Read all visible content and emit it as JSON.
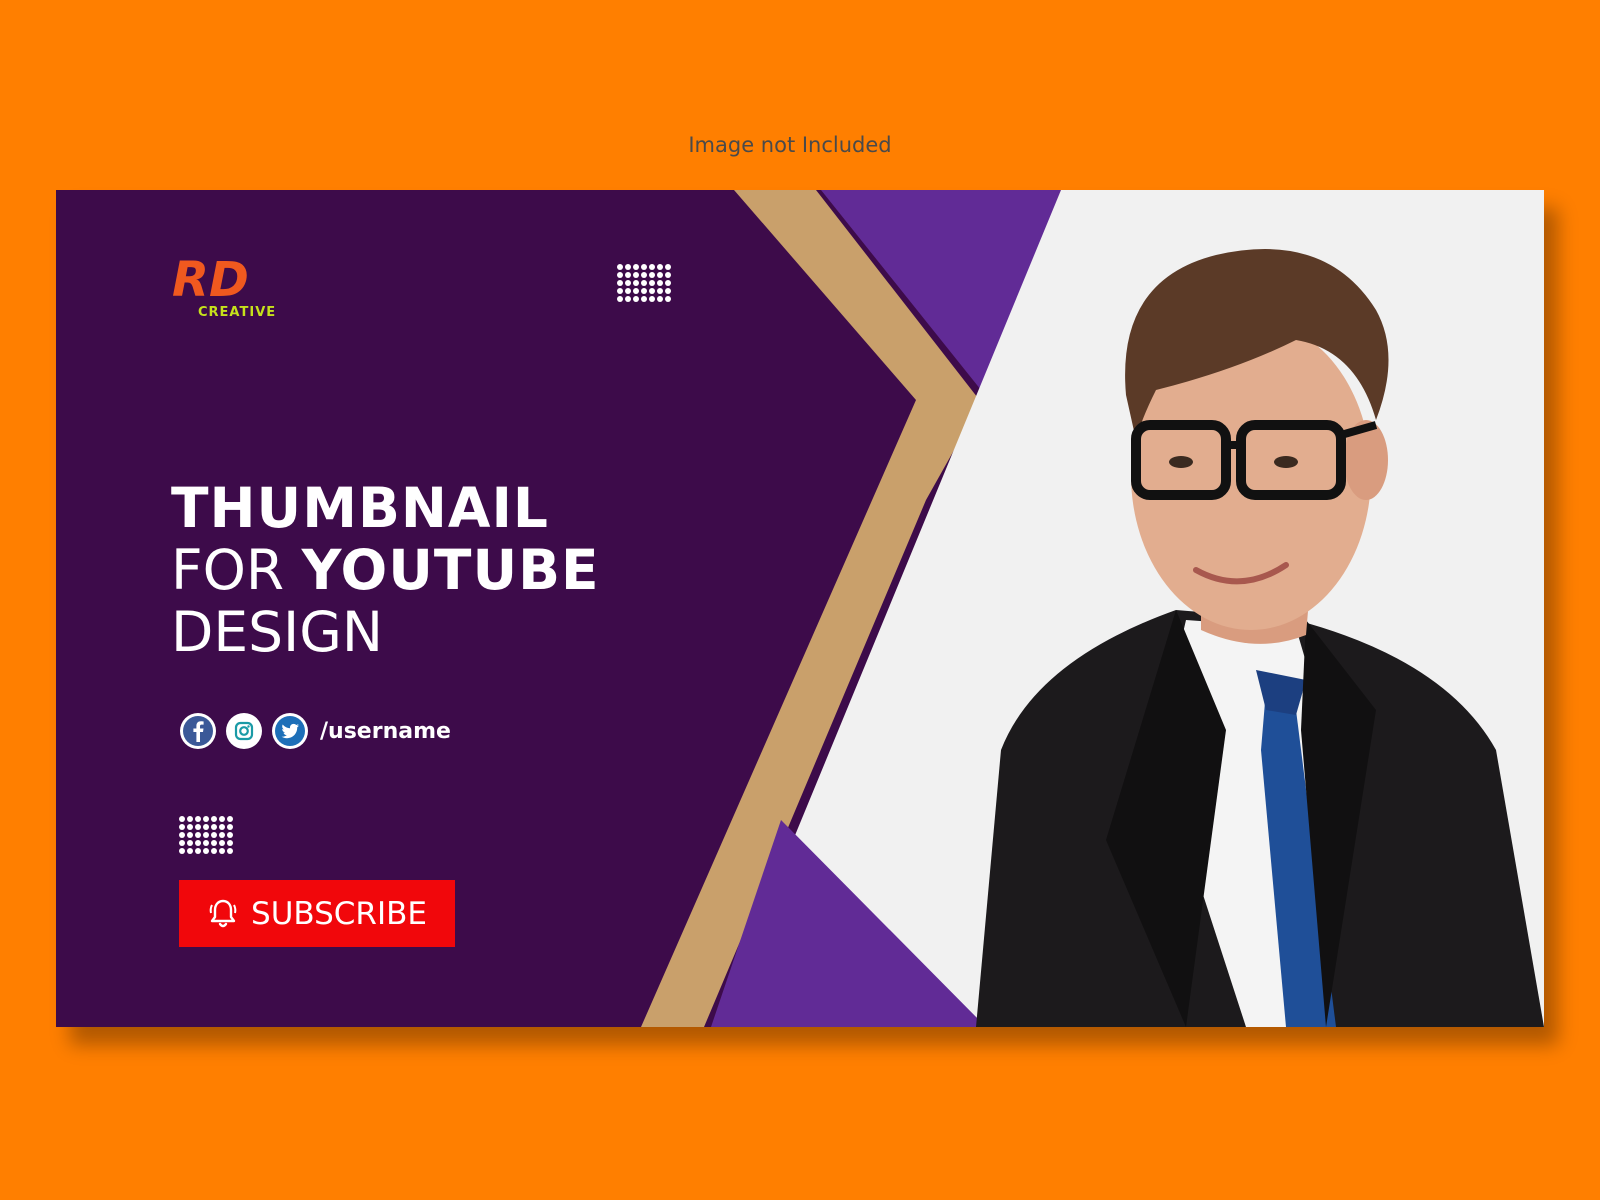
{
  "note": "Image not  Included",
  "logo": {
    "mark": "RD",
    "subtitle": "CREATIVE"
  },
  "headline": {
    "line1": "THUMBNAIL",
    "line2_light": "FOR",
    "line2_bold": "YOUTUBE",
    "line3": "DESIGN"
  },
  "social": {
    "icons": [
      "facebook-icon",
      "instagram-icon",
      "twitter-icon"
    ],
    "handle": "/username"
  },
  "subscribe": {
    "label": "SUBSCRIBE",
    "icon": "bell-icon"
  },
  "colors": {
    "background": "#ff7f00",
    "panel": "#3d0b4a",
    "accent_purple": "#612b96",
    "accent_gold": "#c9a06b",
    "subscribe": "#f1070b",
    "photo_bg": "#f1f1f1"
  }
}
